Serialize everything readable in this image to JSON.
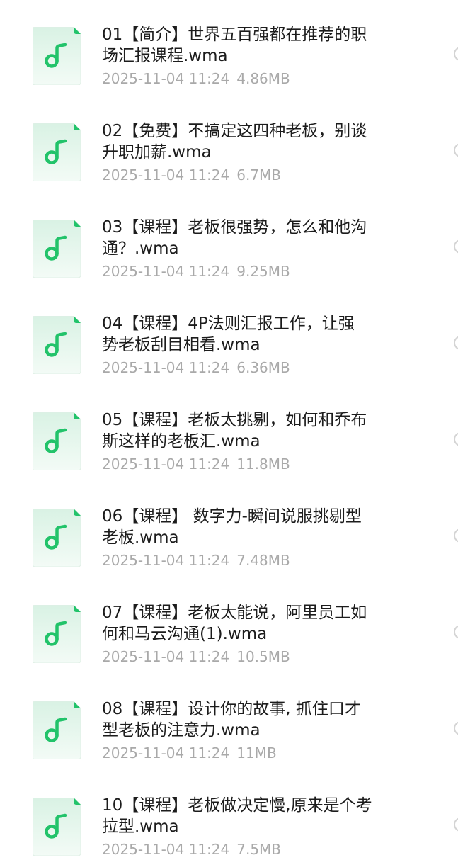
{
  "icon_name": "music-file-icon",
  "accent_color": "#22c36a",
  "files": [
    {
      "name": "01【简介】世界五百强都在推荐的职\n场汇报课程.wma",
      "date": "2025-11-04 11:24",
      "size": "4.86MB"
    },
    {
      "name": "02【免费】不搞定这四种老板，别谈\n升职加薪.wma",
      "date": "2025-11-04 11:24",
      "size": "6.7MB"
    },
    {
      "name": "03【课程】老板很强势，怎么和他沟\n通？.wma",
      "date": "2025-11-04 11:24",
      "size": "9.25MB"
    },
    {
      "name": "04【课程】4P法则汇报工作，让强\n势老板刮目相看.wma",
      "date": "2025-11-04 11:24",
      "size": "6.36MB"
    },
    {
      "name": "05【课程】老板太挑剔，如何和乔布\n斯这样的老板汇.wma",
      "date": "2025-11-04 11:24",
      "size": "11.8MB"
    },
    {
      "name": "06【课程】 数字力-瞬间说服挑剔型\n老板.wma",
      "date": "2025-11-04 11:24",
      "size": "7.48MB"
    },
    {
      "name": "07【课程】老板太能说，阿里员工如\n何和马云沟通(1).wma",
      "date": "2025-11-04 11:24",
      "size": "10.5MB"
    },
    {
      "name": "08【课程】设计你的故事, 抓住口才\n型老板的注意力.wma",
      "date": "2025-11-04 11:24",
      "size": "11MB"
    },
    {
      "name": "10【课程】老板做决定慢,原来是个考\n拉型.wma",
      "date": "2025-11-04 11:24",
      "size": "7.5MB"
    }
  ]
}
